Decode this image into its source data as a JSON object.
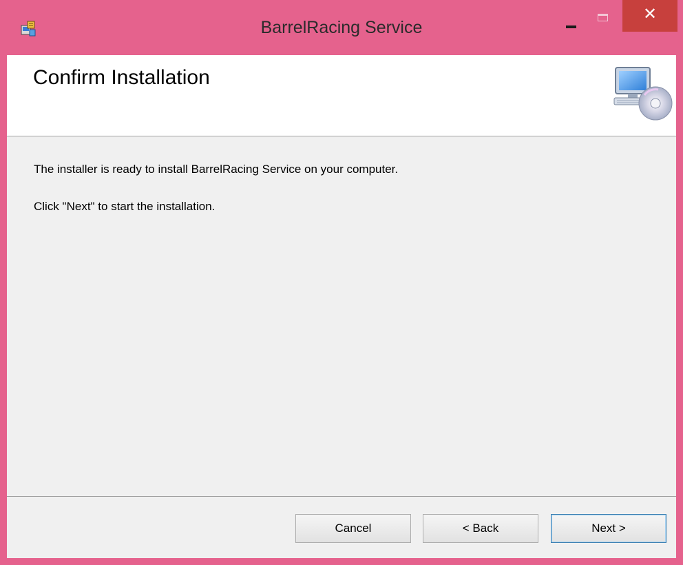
{
  "window": {
    "title": "BarrelRacing Service",
    "colors": {
      "frame": "#e5628d",
      "close_button": "#c7403d",
      "content_bg": "#f0f0f0",
      "header_bg": "#ffffff",
      "default_button_border": "#3c7fb1"
    },
    "app_icon": "installer-package-icon",
    "controls": {
      "minimize_icon": "minimize-icon",
      "maximize_icon": "maximize-icon",
      "close_glyph": "✕"
    }
  },
  "header": {
    "title": "Confirm Installation",
    "icon": "computer-with-cd-icon"
  },
  "content": {
    "line1": "The installer is ready to install BarrelRacing Service on your computer.",
    "line2": "Click \"Next\" to start the installation."
  },
  "buttons": {
    "cancel": "Cancel",
    "back": "< Back",
    "next": "Next >"
  }
}
